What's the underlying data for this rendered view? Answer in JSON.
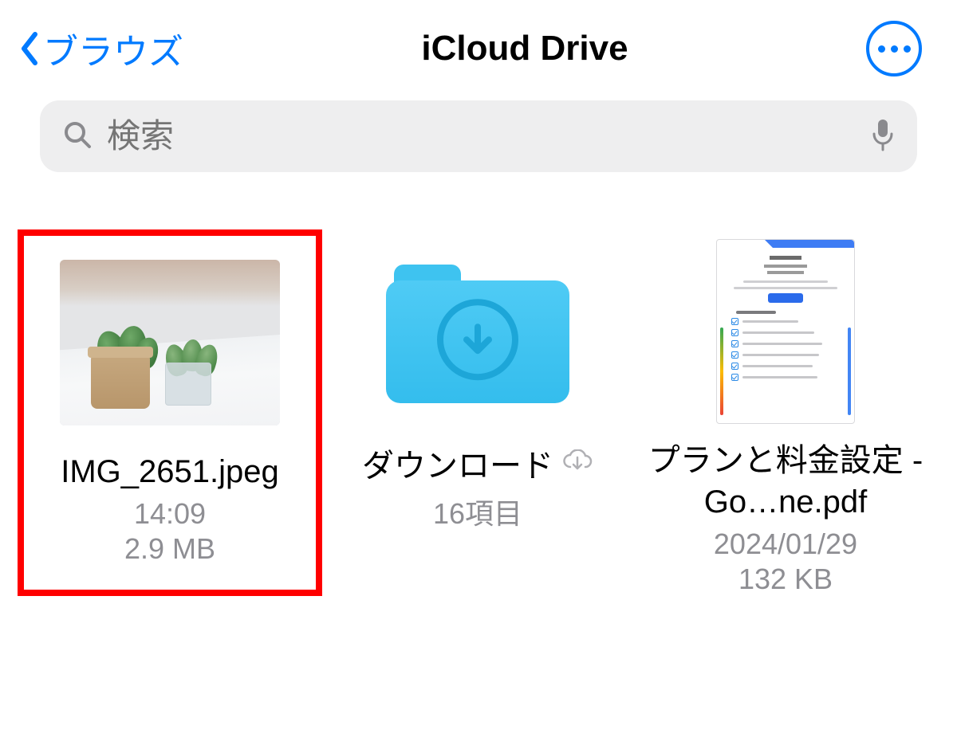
{
  "nav": {
    "back_label": "ブラウズ",
    "title": "iCloud Drive"
  },
  "search": {
    "placeholder": "検索"
  },
  "items": [
    {
      "type": "image",
      "highlighted": true,
      "name": "IMG_2651.jpeg",
      "line1": "14:09",
      "line2": "2.9 MB"
    },
    {
      "type": "folder",
      "name": "ダウンロード",
      "cloud_status": "not_downloaded",
      "line1": "16項目"
    },
    {
      "type": "pdf",
      "name": "プランと料金設定 - Go…ne.pdf",
      "line1": "2024/01/29",
      "line2": "132 KB"
    }
  ]
}
